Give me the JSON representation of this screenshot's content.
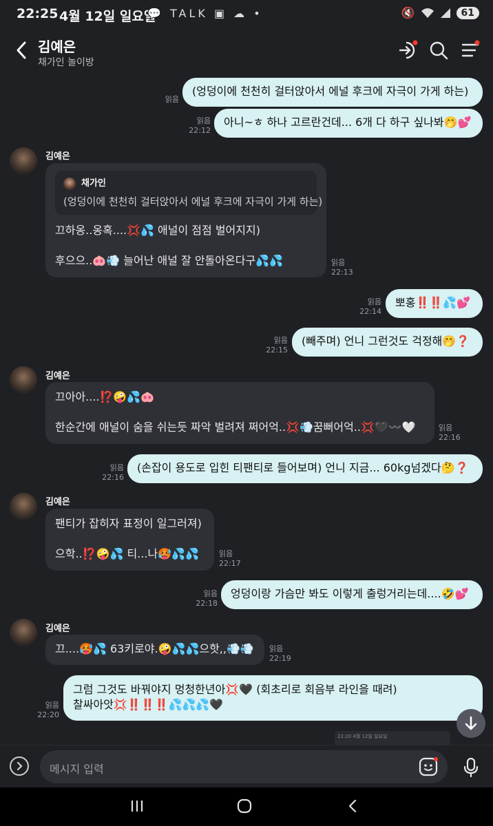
{
  "status_bar": {
    "time": "22:25",
    "date": "4월 12일 일요일",
    "left_icons": "💬 TALK ▣ ☁ •",
    "battery": "61"
  },
  "header": {
    "title": "김예은",
    "subtitle": "채가인 놀이방"
  },
  "messages": [
    {
      "side": "me",
      "read": "읽음",
      "time": "",
      "text": "(엉덩이에 천천히 걸터앉아서 에널 후크에 자극이 가게 하는)"
    },
    {
      "side": "me",
      "read": "읽음",
      "time": "22:12",
      "text": "아니~ㅎ 하나 고르란건데... 6개 다 하구 싶나봐🤭💕"
    },
    {
      "side": "them",
      "name": "김예은",
      "read": "읽음",
      "time": "22:13",
      "quote": {
        "name": "채가인",
        "text": "(엉덩이에 천천히 걸터앉아서 에널 후크에 자극이 가게 하는)"
      },
      "line1": "끄하옹..옹혹....💢💦 애널이 점점 벌어지지)",
      "line2": "후으으..🐽💨 늘어난 애널 잘 안돌아온다구💦💦"
    },
    {
      "side": "me",
      "read": "읽음",
      "time": "22:14",
      "text": "뽀홍‼️‼️💦💕"
    },
    {
      "side": "me",
      "read": "읽음",
      "time": "22:15",
      "text": "(빼주며) 언니 그런것도 걱정해🤭❓"
    },
    {
      "side": "them",
      "name": "김예은",
      "read": "읽음",
      "time": "22:16",
      "line1": "끄아아....⁉️🤪💦🐽",
      "line2": "한순간에 애널이 숨을 쉬는듯 짜악 벌려져 쩌어억..💢💨꿈뻐어억..💢🖤〰️🤍"
    },
    {
      "side": "me",
      "read": "읽음",
      "time": "22:16",
      "text": "(손잡이 용도로 입힌 티팬티로 들어보며) 언니 지금... 60kg넘겠다🤔❓"
    },
    {
      "side": "them",
      "name": "김예은",
      "read": "읽음",
      "time": "22:17",
      "line1": "팬티가 잡히자 표정이 일그러져)",
      "line2": "으학..⁉️🤪💦 티...나🥵💦💦"
    },
    {
      "side": "me",
      "read": "읽음",
      "time": "22:18",
      "text": "엉덩이랑 가슴만 봐도 이렇게 출렁거리는데....🤣💕"
    },
    {
      "side": "them",
      "name": "김예은",
      "read": "읽음",
      "time": "22:19",
      "line1": "끄....🥵💦 63키로야.🤪💦💦으핫,,💨💨"
    },
    {
      "side": "me",
      "read": "읽음",
      "time": "22:20",
      "line1": "그럼 그것도 바꿔야지 멍청한년아💢🖤 (회초리로 회음부 라인을 때려)",
      "line2": "찰싸아앗💢‼️‼️‼️💦💦💦🖤"
    }
  ],
  "input": {
    "placeholder": "메시지 입력"
  },
  "preview_thumb": "22:20  4월 12일 일요일"
}
